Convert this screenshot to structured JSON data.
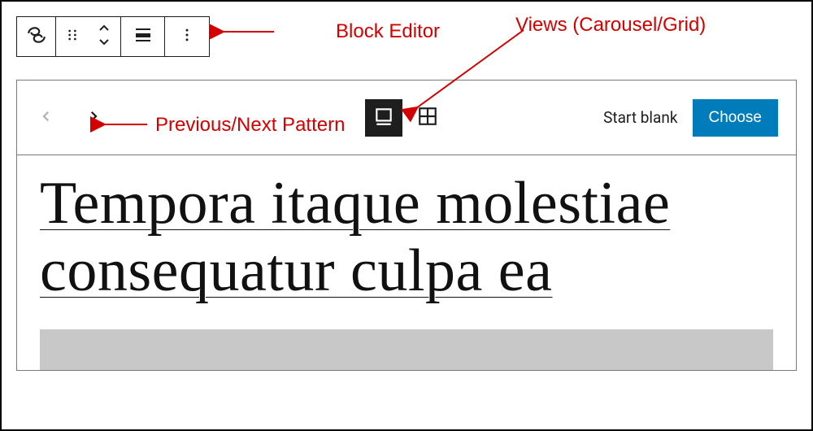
{
  "annotations": {
    "block_editor": "Block Editor",
    "views": "Views (Carousel/Grid)",
    "prev_next": "Previous/Next Pattern"
  },
  "panel": {
    "start_blank": "Start blank",
    "choose": "Choose"
  },
  "content": {
    "title": "Tempora itaque molestiae consequatur culpa ea"
  },
  "icons": {
    "block_type": "query-loop-icon",
    "drag": "drag-handle-icon",
    "move": "move-up-down-icon",
    "align": "align-icon",
    "options": "more-options-icon",
    "prev": "chevron-left-icon",
    "next": "chevron-right-icon",
    "carousel": "carousel-view-icon",
    "grid": "grid-view-icon"
  },
  "colors": {
    "accent": "#007cba",
    "annotation": "#d40000"
  }
}
